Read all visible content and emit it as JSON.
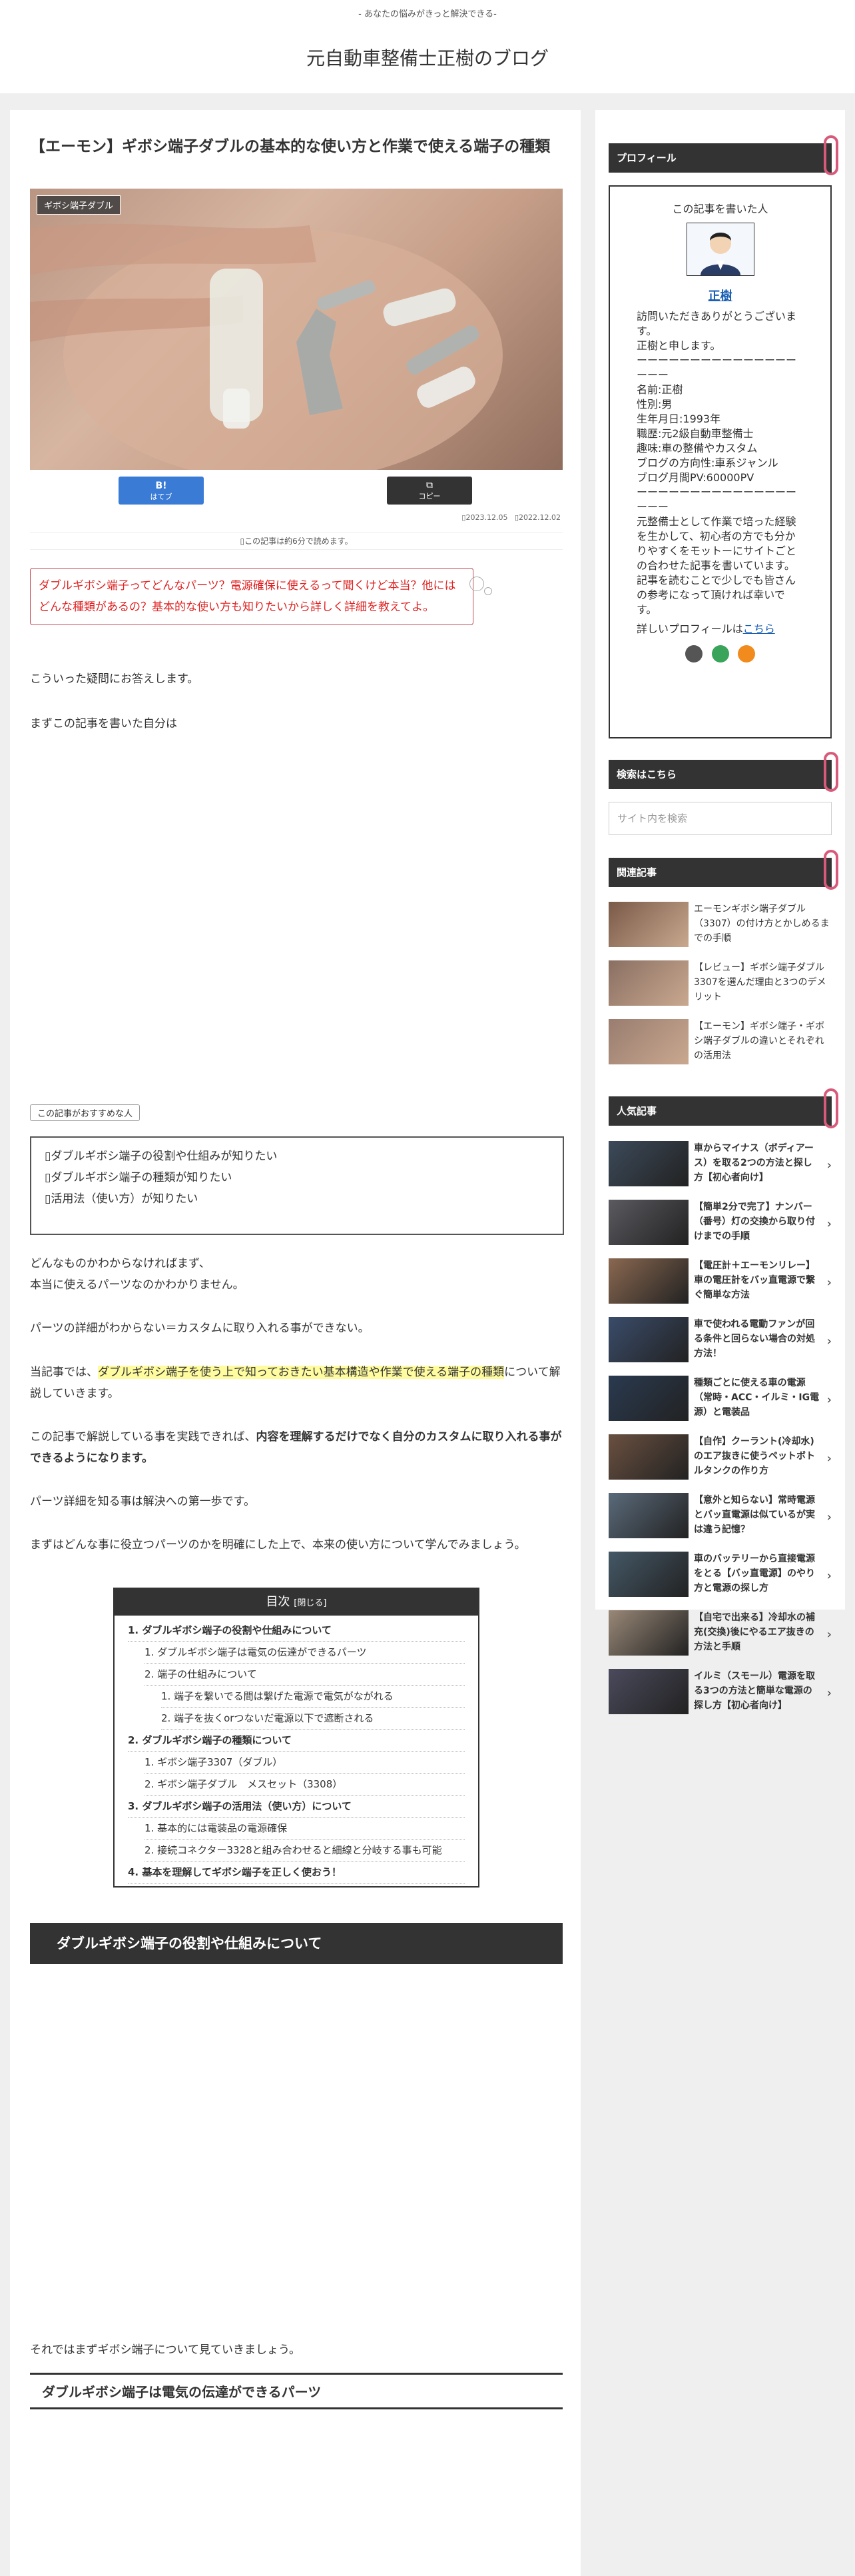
{
  "header": {
    "tagline": "- あなたの悩みがきっと解決できる-",
    "site_title": "元自動車整備士正樹のブログ"
  },
  "article": {
    "title": "【エーモン】ギボシ端子ダブルの基本的な使い方と作業で使える端子の種類",
    "category": "ギボシ端子ダブル",
    "share_hatena": "B!",
    "share_hatena_label": "はてブ",
    "share_copy": "⧉",
    "share_copy_label": "コピー",
    "date_updated": "▯2023.12.05",
    "date_published": "▯2022.12.02",
    "read_time": "▯この記事は約6分で読めます。",
    "speech": "ダブルギボシ端子ってどんなパーツ？電源確保に使えるって聞くけど本当？他にはどんな種類があるの？基本的な使い方も知りたいから詳しく詳細を教えてよ。",
    "p1": "こういった疑問にお答えします。",
    "p2": "まずこの記事を書いた自分は",
    "rec_label": "この記事がおすすめな人",
    "rec_items": [
      "▯ダブルギボシ端子の役割や仕組みが知りたい",
      "▯ダブルギボシ端子の種類が知りたい",
      "▯活用法（使い方）が知りたい"
    ],
    "p3": "どんなものかわからなければまず、",
    "p3b": "本当に使えるパーツなのかわかりません。",
    "p4": "パーツの詳細がわからない＝カスタムに取り入れる事ができない。",
    "p5a": "当記事では、",
    "p5hl": "ダブルギボシ端子を使う上で知っておきたい基本構造や作業で使える端子の種類",
    "p5b": "について解説していきます。",
    "p6a": "この記事で解説している事を実践できれば、",
    "p6b": "内容を理解するだけでなく自分のカスタムに取り入れる事ができるようになります。",
    "p7": "パーツ詳細を知る事は解決への第一歩です。",
    "p8": "まずはどんな事に役立つパーツのかを明確にした上で、本来の使い方について学んでみましょう。",
    "toc_title": "目次",
    "toc_toggle": "[閉じる]",
    "toc": [
      {
        "level": 1,
        "text": "1. ダブルギボシ端子の役割や仕組みについて"
      },
      {
        "level": 2,
        "text": "1. ダブルギボシ端子は電気の伝達ができるパーツ"
      },
      {
        "level": 2,
        "text": "2. 端子の仕組みについて"
      },
      {
        "level": 3,
        "text": "1. 端子を繋いでる間は繋げた電源で電気がながれる"
      },
      {
        "level": 3,
        "text": "2. 端子を抜くorつないだ電源以下で遮断される"
      },
      {
        "level": 1,
        "text": "2. ダブルギボシ端子の種類について"
      },
      {
        "level": 2,
        "text": "1. ギボシ端子3307（ダブル）"
      },
      {
        "level": 2,
        "text": "2. ギボシ端子ダブル　メスセット（3308）"
      },
      {
        "level": 1,
        "text": "3. ダブルギボシ端子の活用法（使い方）について"
      },
      {
        "level": 2,
        "text": "1. 基本的には電装品の電源確保"
      },
      {
        "level": 2,
        "text": "2. 接続コネクター3328と組み合わせると細線と分岐する事も可能"
      },
      {
        "level": 1,
        "text": "4. 基本を理解してギボシ端子を正しく使おう！"
      }
    ],
    "h2": "ダブルギボシ端子の役割や仕組みについて",
    "p9": "それではまずギボシ端子について見ていきましょう。",
    "h3": "ダブルギボシ端子は電気の伝達ができるパーツ"
  },
  "sidebar": {
    "profile_head": "プロフィール",
    "profile_written": "この記事を書いた人",
    "profile_name": "正樹",
    "profile_lines": [
      "訪問いただきありがとうございます。",
      "正樹と申します。",
      "ーーーーーーーーーーーーーーーーーー",
      "名前:正樹",
      "性別:男",
      "生年月日:1993年",
      "職歴:元2級自動車整備士",
      "趣味:車の整備やカスタム",
      "ブログの方向性:車系ジャンル",
      "ブログ月間PV:60000PV",
      "ーーーーーーーーーーーーーーーーーー",
      "元整備士として作業で培った経験を生かして、初心者の方でも分かりやすくをモットーにサイトごとの合わせた記事を書いています。",
      "記事を読むことで少しでも皆さんの参考になって頂ければ幸いです。"
    ],
    "profile_more": "詳しいプロフィールは",
    "profile_link": "こちら",
    "search_head": "検索はこちら",
    "search_placeholder": "サイト内を検索",
    "related_head": "関連記事",
    "related": [
      "エーモンギボシ端子ダブル（3307）の付け方とかしめるまでの手順",
      "【レビュー】ギボシ端子ダブル3307を選んだ理由と3つのデメリット",
      "【エーモン】ギボシ端子・ギボシ端子ダブルの違いとそれぞれの活用法"
    ],
    "popular_head": "人気記事",
    "popular": [
      "車からマイナス（ボディアース）を取る2つの方法と探し方【初心者向け】",
      "【簡単2分で完了】ナンバー（番号）灯の交換から取り付けまでの手順",
      "【電圧計＋エーモンリレー】車の電圧計をバッ直電源で繋ぐ簡単な方法",
      "車で使われる電動ファンが回る条件と回らない場合の対処方法！",
      "種類ごとに使える車の電源（常時・ACC・イルミ・IG電源）と電装品",
      "【自作】クーラント(冷却水)のエア抜きに使うペットボトルタンクの作り方",
      "【意外と知らない】常時電源とバッ直電源は似ているが実は違う記憶？",
      "車のバッテリーから直接電源をとる【バッ直電源】のやり方と電源の探し方",
      "【自宅で出来る】冷却水の補充(交換)後にやるエア抜きの方法と手順",
      "イルミ（スモール）電源を取る3つの方法と簡単な電源の探し方【初心者向け】"
    ]
  },
  "colors": {
    "accent_red": "#e02323",
    "dark": "#333333",
    "link": "#1a5fb4",
    "clip": "#d85a7a"
  }
}
